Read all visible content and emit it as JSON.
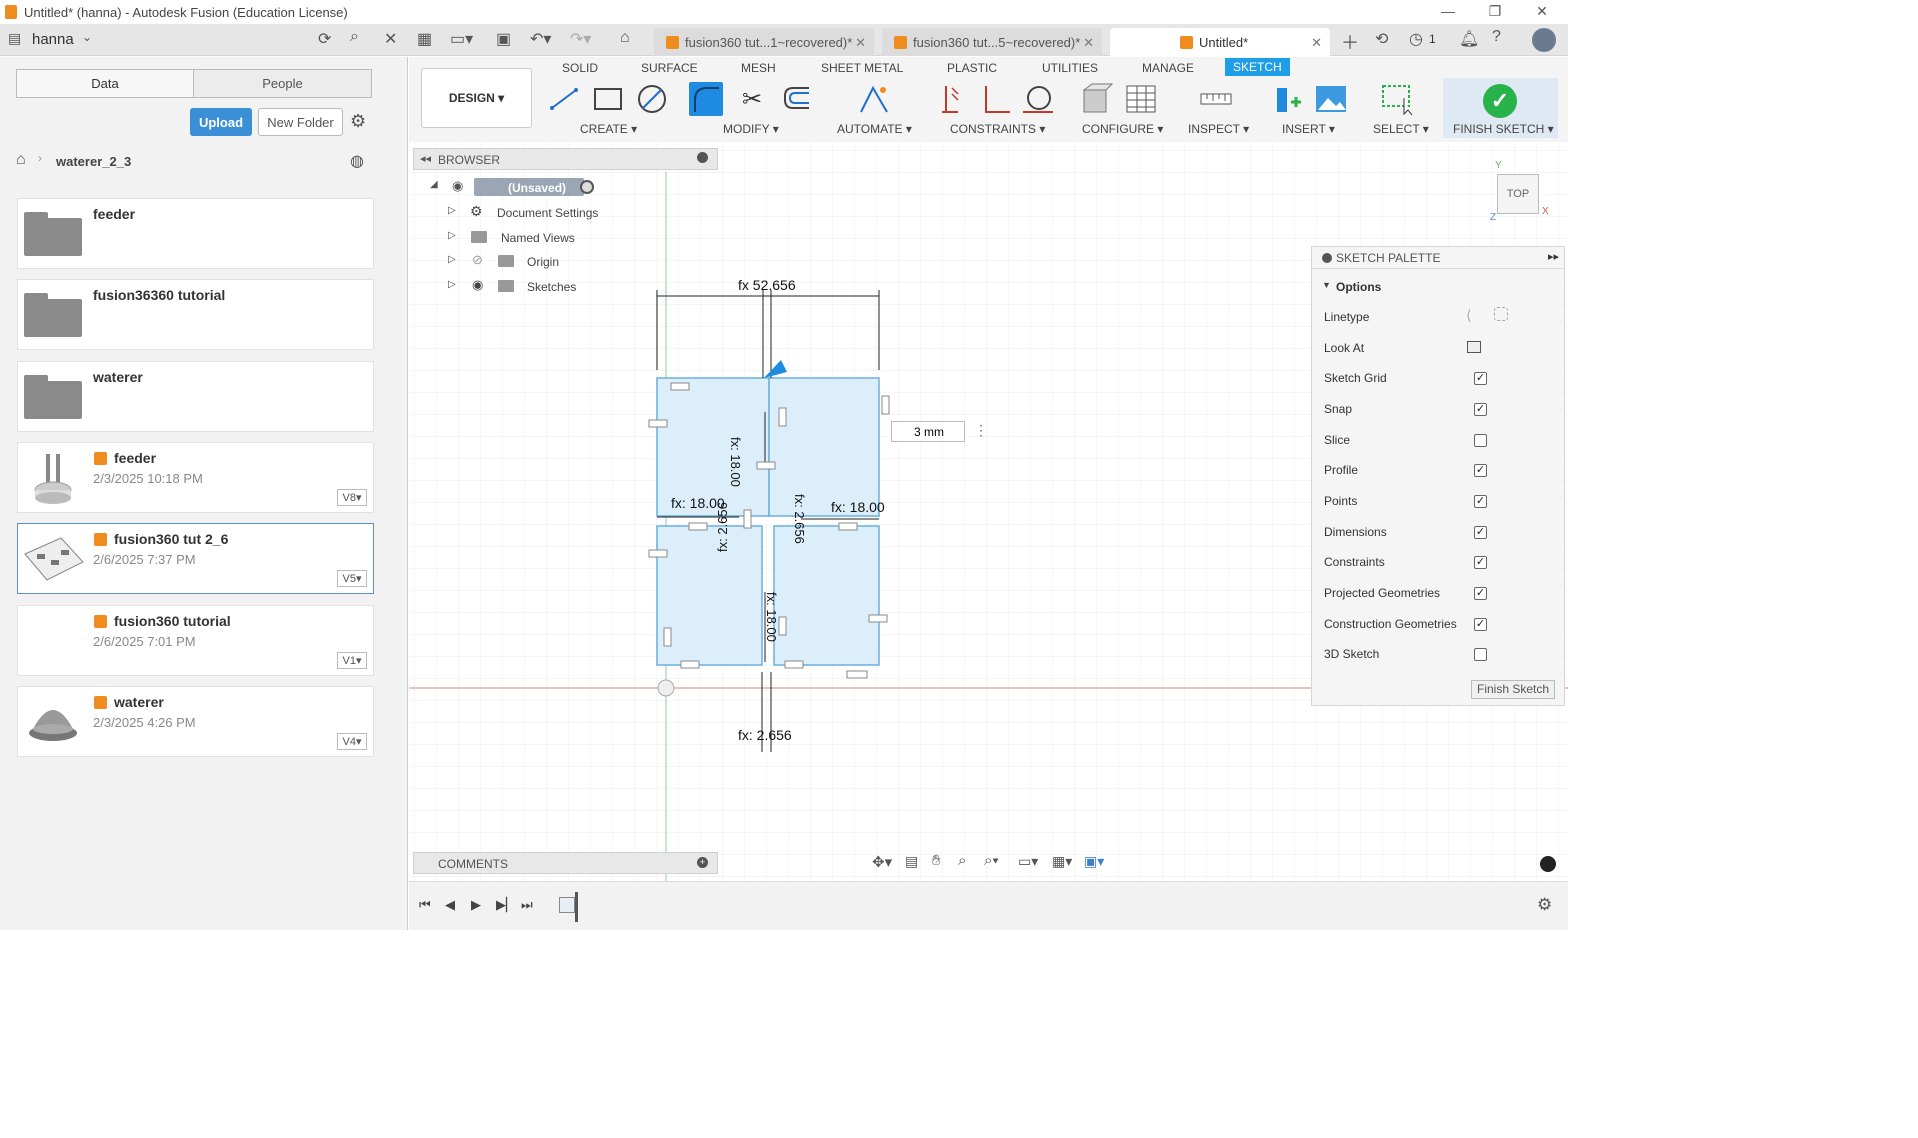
{
  "window": {
    "title": "Untitled* (hanna) - Autodesk Fusion (Education License)"
  },
  "appbar": {
    "user": "hanna",
    "tabs": [
      {
        "label": "fusion360 tut...1~recovered)*"
      },
      {
        "label": "fusion360 tut...5~recovered)*"
      },
      {
        "label": "Untitled*"
      }
    ],
    "jobs_count": "1"
  },
  "data_panel": {
    "seg_data": "Data",
    "seg_people": "People",
    "upload": "Upload",
    "new_folder": "New Folder",
    "breadcrumb": "waterer_2_3",
    "items": [
      {
        "name": "feeder",
        "type": "folder"
      },
      {
        "name": "fusion36360 tutorial",
        "type": "folder"
      },
      {
        "name": "waterer",
        "type": "folder"
      },
      {
        "name": "feeder",
        "type": "design",
        "date": "2/3/2025 10:18 PM",
        "version": "V8"
      },
      {
        "name": "fusion360 tut 2_6",
        "type": "design",
        "date": "2/6/2025 7:37 PM",
        "version": "V5"
      },
      {
        "name": "fusion360 tutorial",
        "type": "design",
        "date": "2/6/2025 7:01 PM",
        "version": "V1"
      },
      {
        "name": "waterer",
        "type": "design",
        "date": "2/3/2025 4:26 PM",
        "version": "V4"
      }
    ]
  },
  "ribbon": {
    "workspace": "DESIGN",
    "tabs": [
      "SOLID",
      "SURFACE",
      "MESH",
      "SHEET METAL",
      "PLASTIC",
      "UTILITIES",
      "MANAGE",
      "SKETCH"
    ],
    "groups": [
      "CREATE",
      "MODIFY",
      "AUTOMATE",
      "CONSTRAINTS",
      "CONFIGURE",
      "INSPECT",
      "INSERT",
      "SELECT",
      "FINISH SKETCH"
    ]
  },
  "browser": {
    "title": "BROWSER",
    "root": "(Unsaved)",
    "nodes": [
      "Document Settings",
      "Named Views",
      "Origin",
      "Sketches"
    ]
  },
  "sketch": {
    "dim_top": "fx 52.656",
    "dim_top_alt": "fx: 2.656",
    "dim_left": "fx: 18.00",
    "dim_right": "fx: 18.00",
    "dim_bottom": "fx: 2.656",
    "dim_vert_top": "fx: 18.00",
    "dim_vert_bottom": "fx: 18.00",
    "dim_mid_left": "fx: 2.656",
    "dim_mid_right": "fx: 2.656",
    "input_value": "3 mm"
  },
  "viewcube": {
    "face": "TOP",
    "y": "Y",
    "x": "X",
    "z": "Z"
  },
  "palette": {
    "title": "SKETCH PALETTE",
    "section": "Options",
    "rows": [
      {
        "label": "Linetype"
      },
      {
        "label": "Look At"
      },
      {
        "label": "Sketch Grid",
        "checked": true
      },
      {
        "label": "Snap",
        "checked": true
      },
      {
        "label": "Slice",
        "checked": false
      },
      {
        "label": "Profile",
        "checked": true
      },
      {
        "label": "Points",
        "checked": true
      },
      {
        "label": "Dimensions",
        "checked": true
      },
      {
        "label": "Constraints",
        "checked": true
      },
      {
        "label": "Projected Geometries",
        "checked": true
      },
      {
        "label": "Construction Geometries",
        "checked": true
      },
      {
        "label": "3D Sketch",
        "checked": false
      }
    ],
    "finish": "Finish Sketch"
  },
  "comments": {
    "label": "COMMENTS"
  },
  "colors": {
    "accent": "#1e9ee8",
    "upload": "#3a8fd6",
    "finish_green": "#27b24a",
    "sketch_fill": "#dceefa",
    "sketch_line": "#6ab0e0"
  }
}
